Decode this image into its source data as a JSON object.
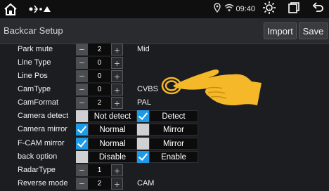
{
  "status": {
    "time": "09:40"
  },
  "header": {
    "title": "Backcar Setup",
    "import_label": "Import",
    "save_label": "Save"
  },
  "rows": [
    {
      "label": "Park mute",
      "type": "stepper",
      "value": "2",
      "extra": "Mid"
    },
    {
      "label": "Line Type",
      "type": "stepper",
      "value": "0",
      "extra": ""
    },
    {
      "label": "Line Pos",
      "type": "stepper",
      "value": "0",
      "extra": ""
    },
    {
      "label": "CamType",
      "type": "stepper",
      "value": "0",
      "extra": "CVBS"
    },
    {
      "label": "CamFormat",
      "type": "stepper",
      "value": "2",
      "extra": "PAL"
    },
    {
      "label": "Camera detect",
      "type": "options",
      "options": [
        {
          "label": "Not detect",
          "checked": false
        },
        {
          "label": "Detect",
          "checked": true
        }
      ]
    },
    {
      "label": "Camera mirror",
      "type": "options",
      "options": [
        {
          "label": "Normal",
          "checked": true
        },
        {
          "label": "Mirror",
          "checked": false
        }
      ]
    },
    {
      "label": "F-CAM mirror",
      "type": "options",
      "options": [
        {
          "label": "Normal",
          "checked": true
        },
        {
          "label": "Mirror",
          "checked": false
        }
      ]
    },
    {
      "label": "back option",
      "type": "options",
      "options": [
        {
          "label": "Disable",
          "checked": false
        },
        {
          "label": "Enable",
          "checked": true
        }
      ]
    },
    {
      "label": "RadarType",
      "type": "stepper",
      "value": "1",
      "extra": ""
    },
    {
      "label": "Reverse mode",
      "type": "stepper",
      "value": "2",
      "extra": "CAM"
    }
  ],
  "colors": {
    "accent": "#1e9be8",
    "hand": "#f5b829"
  },
  "icons": [
    "home-icon",
    "notification-icons",
    "location-icon",
    "wifi-icon",
    "brightness-icon",
    "recent-apps-icon",
    "back-icon",
    "pointing-hand-icon"
  ]
}
